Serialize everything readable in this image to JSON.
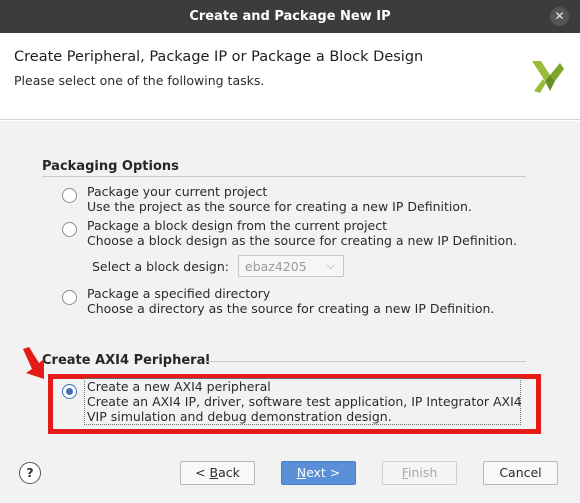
{
  "window": {
    "title": "Create and Package New IP",
    "close_glyph": "✕"
  },
  "header": {
    "title": "Create Peripheral, Package IP or Package a Block Design",
    "subtitle": "Please select one of the following tasks.",
    "logo_icon": "vivado-logo-icon"
  },
  "packaging": {
    "section_title": "Packaging Options",
    "options": [
      {
        "label": "Package your current project",
        "description": "Use the project as the source for creating a new IP Definition.",
        "selected": false
      },
      {
        "label": "Package a block design from the current project",
        "description": "Choose a block design as the source for creating a new IP Definition.",
        "selected": false
      },
      {
        "label": "Package a specified directory",
        "description": "Choose a directory as the source for creating a new IP Definition.",
        "selected": false
      }
    ],
    "block_design_label": "Select a block design:",
    "block_design_value": "ebaz4205"
  },
  "axi4": {
    "section_title": "Create AXI4 Peripheral",
    "option_label": "Create a new AXI4 peripheral",
    "option_desc_line1": "Create an AXI4 IP, driver, software test application, IP Integrator AXI4",
    "option_desc_line2": "VIP simulation and debug demonstration design.",
    "selected": true
  },
  "footer": {
    "help_glyph": "?",
    "back_mnemonic": "B",
    "back_rest": "ack",
    "back_prefix": "< ",
    "next_mnemonic": "N",
    "next_rest": "ext >",
    "finish_mnemonic": "F",
    "finish_rest": "inish",
    "cancel_label": "Cancel"
  },
  "colors": {
    "accent": "#5b8fd8",
    "annotation_red": "#e41b17",
    "titlebar": "#3c3c3c"
  }
}
